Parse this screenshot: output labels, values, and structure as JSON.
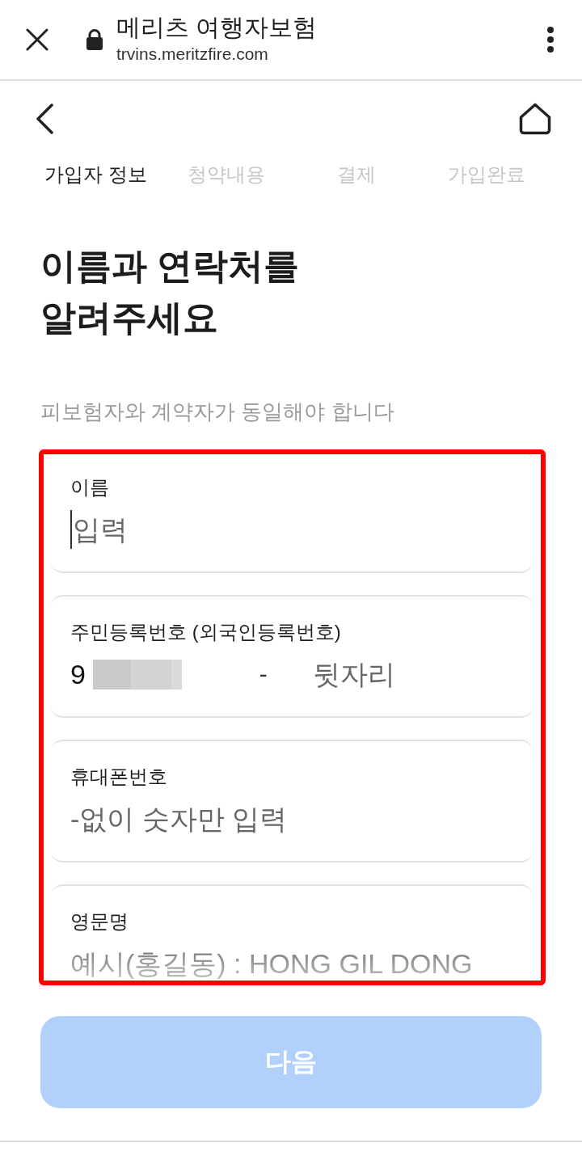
{
  "browser_bar": {
    "title": "메리츠 여행자보험",
    "url": "trvins.meritzfire.com"
  },
  "steps": [
    {
      "label": "가입자 정보",
      "selected": true
    },
    {
      "label": "청약내용",
      "selected": false
    },
    {
      "label": "결제",
      "selected": false
    },
    {
      "label": "가입완료",
      "selected": false
    }
  ],
  "heading": "이름과 연락처를\n알려주세요",
  "subtitle": "피보험자와 계약자가 동일해야 합니다",
  "fields": [
    {
      "kind": "text",
      "label": "이름",
      "placeholder": "입력",
      "focused": true
    },
    {
      "kind": "id_number",
      "label": "주민등록번호 (외국인등록번호)",
      "value": "9",
      "redacted": true,
      "separator": "-",
      "placeholder": "뒷자리",
      "focused": false
    },
    {
      "kind": "text",
      "label": "휴대폰번호",
      "placeholder": "-없이 숫자만 입력",
      "focused": false
    },
    {
      "kind": "text",
      "label": "영문명",
      "placeholder": "예시(홍길동) : HONG GIL DONG",
      "focused": false
    }
  ],
  "next_button": {
    "label": "다음",
    "disabled": true
  }
}
